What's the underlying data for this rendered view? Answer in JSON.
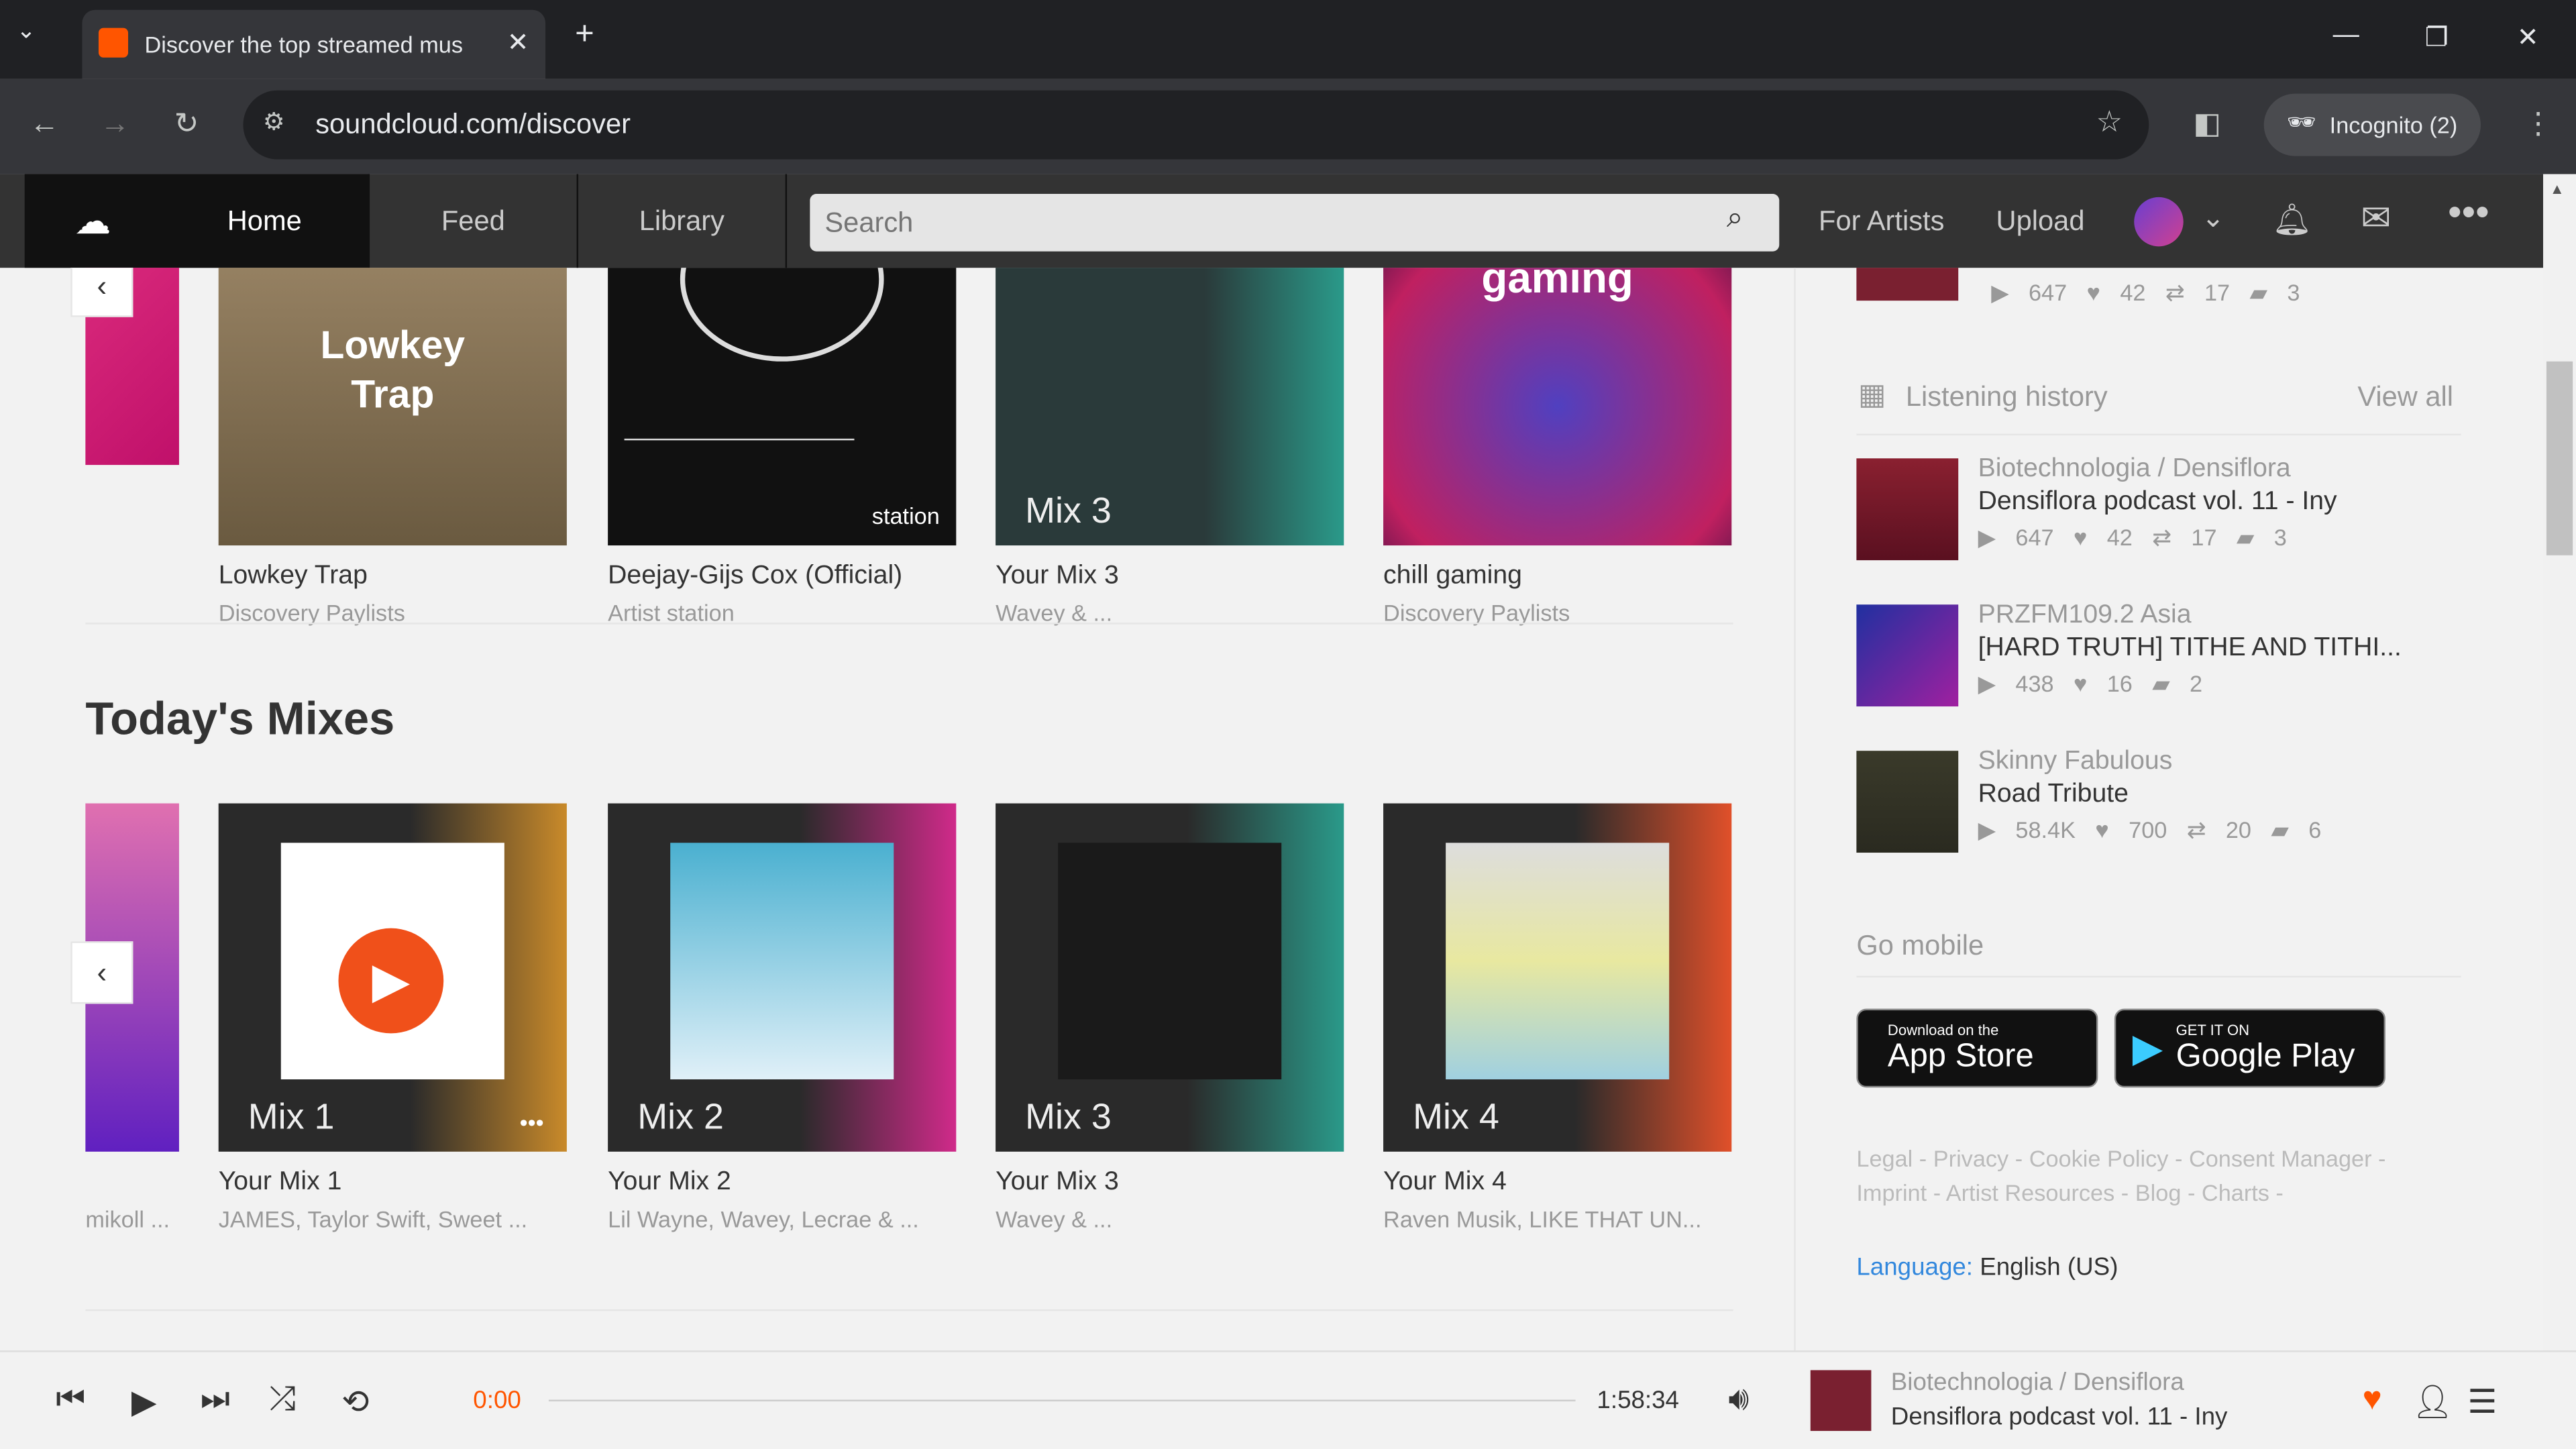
{
  "browser": {
    "tab_title": "Discover the top streamed mus",
    "url": "soundcloud.com/discover",
    "incognito": "Incognito (2)"
  },
  "header": {
    "tabs": [
      "Home",
      "Feed",
      "Library"
    ],
    "search_placeholder": "Search",
    "for_artists": "For Artists",
    "upload": "Upload"
  },
  "top_row": [
    {
      "title": "Lowkey Trap",
      "subtitle": "Discovery Paylists",
      "overlay": "Lowkey\nTrap"
    },
    {
      "title": "Deejay-Gijs Cox (Official)",
      "subtitle": "Artist station",
      "overlay": "station"
    },
    {
      "title": "Your Mix 3",
      "subtitle": "Wavey & ...",
      "overlay": "Mix 3"
    },
    {
      "title": "chill gaming",
      "subtitle": "Discovery Paylists",
      "overlay": "gaming"
    }
  ],
  "todays_mixes": {
    "heading": "Today's Mixes",
    "partial_subtitle": "mikoll ...",
    "items": [
      {
        "label": "Mix 1",
        "title": "Your Mix 1",
        "subtitle": "JAMES, Taylor Swift, Sweet ...",
        "color": "#c98a2a"
      },
      {
        "label": "Mix 2",
        "title": "Your Mix 2",
        "subtitle": "Lil Wayne, Wavey, Lecrae & ...",
        "color": "#d02a8a"
      },
      {
        "label": "Mix 3",
        "title": "Your Mix 3",
        "subtitle": "Wavey & ...",
        "color": "#2a9a8a"
      },
      {
        "label": "Mix 4",
        "title": "Your Mix 4",
        "subtitle": "Raven Musik, LIKE THAT UN...",
        "color": "#e0502a"
      }
    ]
  },
  "sidebar": {
    "top_stats": {
      "plays": "647",
      "likes": "42",
      "reposts": "17",
      "comments": "3"
    },
    "history_title": "Listening history",
    "view_all": "View all",
    "history": [
      {
        "artist": "Biotechnologia / Densiflora",
        "track": "Densiflora podcast vol. 11 - Iny",
        "plays": "647",
        "likes": "42",
        "reposts": "17",
        "comments": "3"
      },
      {
        "artist": "PRZFM109.2 Asia",
        "track": "[HARD TRUTH] TITHE AND TITHI...",
        "plays": "438",
        "likes": "16",
        "comments": "2"
      },
      {
        "artist": "Skinny Fabulous",
        "track": "Road Tribute",
        "plays": "58.4K",
        "likes": "700",
        "reposts": "20",
        "comments": "6"
      }
    ],
    "go_mobile": "Go mobile",
    "app_store": {
      "small": "Download on the",
      "big": "App Store"
    },
    "google_play": {
      "small": "GET IT ON",
      "big": "Google Play"
    },
    "footer_links": [
      "Legal",
      "Privacy",
      "Cookie Policy",
      "Consent Manager",
      "Imprint",
      "Artist Resources",
      "Blog",
      "Charts"
    ],
    "language_label": "Language:",
    "language_value": "English (US)"
  },
  "player": {
    "elapsed": "0:00",
    "duration": "1:58:34",
    "progress": 0,
    "artist": "Biotechnologia / Densiflora",
    "track": "Densiflora podcast vol. 11 - Iny",
    "accent": "#ff5500"
  }
}
